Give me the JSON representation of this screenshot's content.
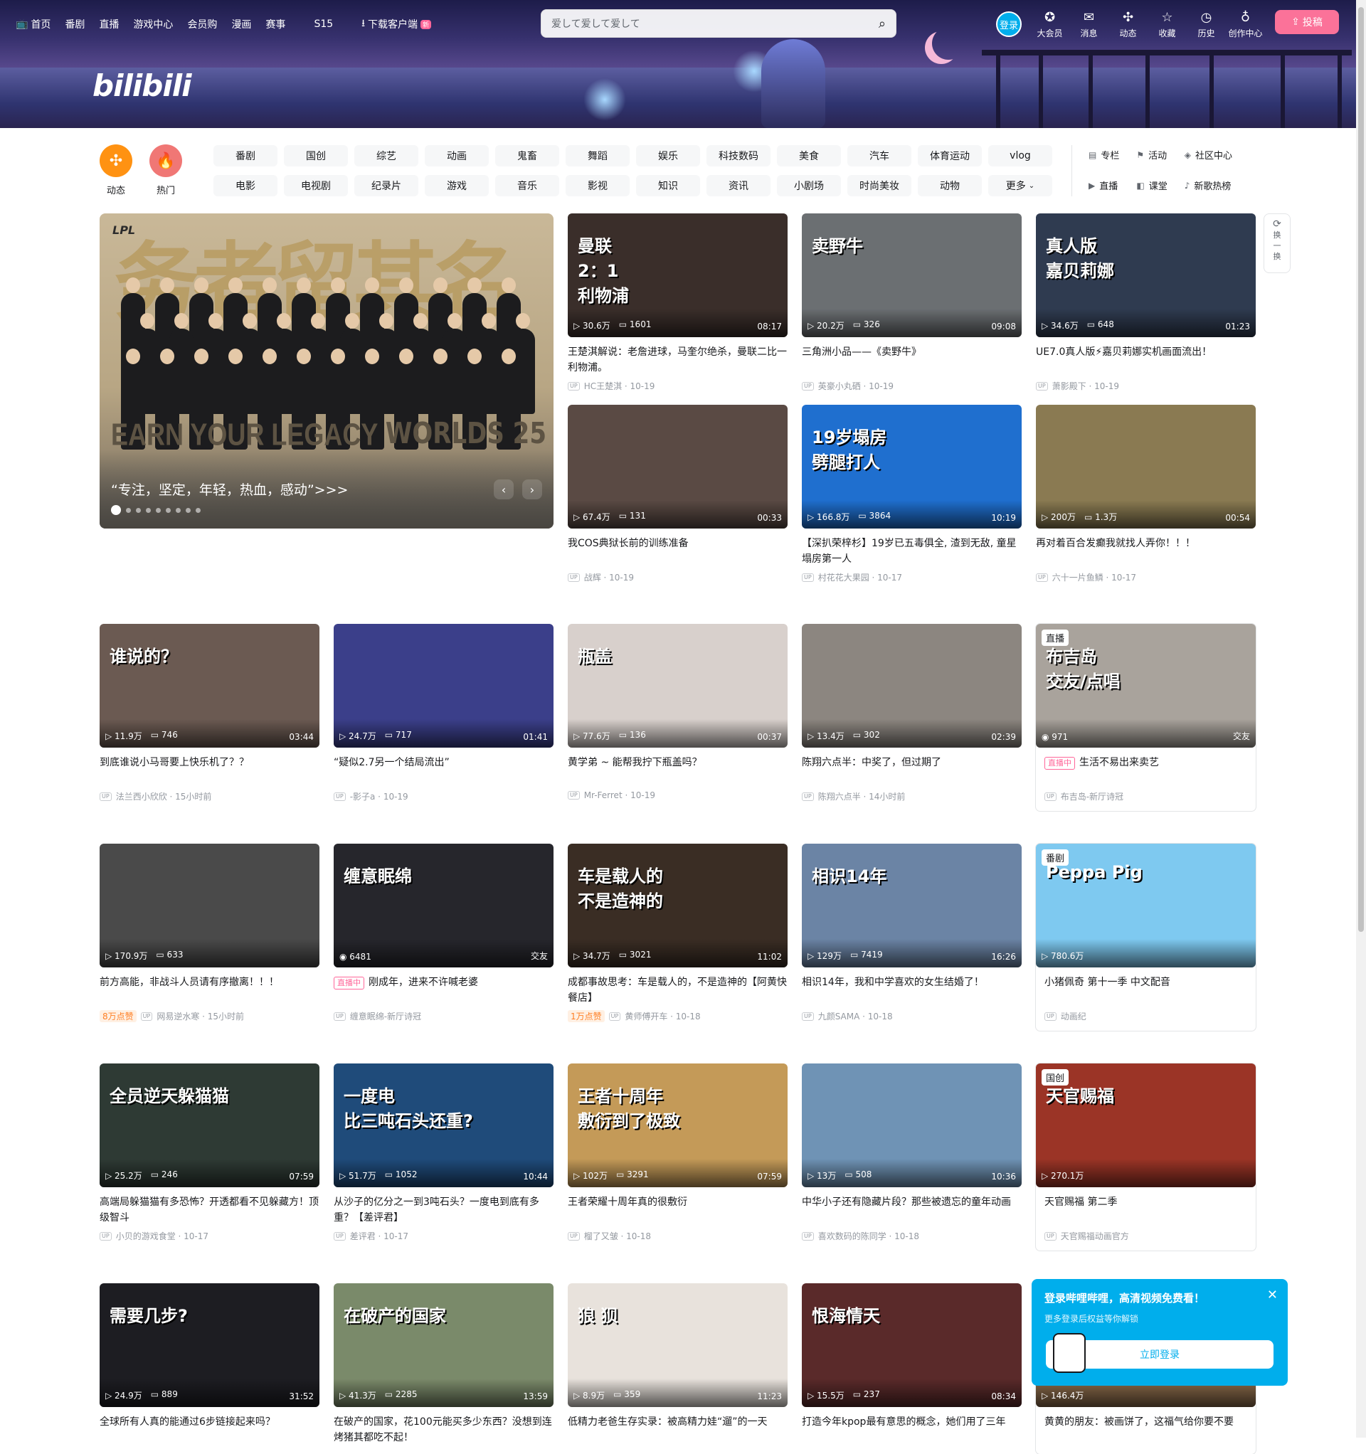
{
  "header": {
    "nav": [
      "首页",
      "番剧",
      "直播",
      "游戏中心",
      "会员购",
      "漫画",
      "赛事",
      "S15",
      "下载客户端"
    ],
    "new_badge": "新",
    "search_placeholder": "爱して爱して爱して",
    "login": "登录",
    "right_nav": [
      {
        "label": "大会员",
        "icon": "vip-icon"
      },
      {
        "label": "消息",
        "icon": "message-icon"
      },
      {
        "label": "动态",
        "icon": "dynamic-icon"
      },
      {
        "label": "收藏",
        "icon": "favorite-icon"
      },
      {
        "label": "历史",
        "icon": "history-icon"
      },
      {
        "label": "创作中心",
        "icon": "creator-icon"
      }
    ],
    "upload": "投稿",
    "logo": "bilibili"
  },
  "quick": [
    {
      "label": "动态",
      "color": "#ff9212"
    },
    {
      "label": "热门",
      "color": "#f07775"
    }
  ],
  "channels": [
    "番剧",
    "国创",
    "综艺",
    "动画",
    "鬼畜",
    "舞蹈",
    "娱乐",
    "科技数码",
    "美食",
    "汽车",
    "体育运动",
    "vlog",
    "电影",
    "电视剧",
    "纪录片",
    "游戏",
    "音乐",
    "影视",
    "知识",
    "资讯",
    "小剧场",
    "时尚美妆",
    "动物",
    "更多"
  ],
  "extra": [
    "专栏",
    "活动",
    "社区中心",
    "直播",
    "课堂",
    "新歌热榜"
  ],
  "carousel": {
    "caption": "“专注，坚定，年轻，热血，感动”>>>",
    "earn": "EARN YOUR LEGACY",
    "worlds": "WORLDS 25",
    "lpl": "LPL",
    "calli": "务者留其名"
  },
  "refresh": [
    "换",
    "一",
    "换"
  ],
  "cards": [
    {
      "title": "王楚淇解说：老詹进球，马奎尔绝杀，曼联二比一利物浦。",
      "plays": "30.6万",
      "danmaku": "1601",
      "duration": "08:17",
      "up": "HC王楚淇",
      "date": "10-19",
      "art": "曼联\n2：1\n利物浦",
      "bg": "#3a2e2a"
    },
    {
      "title": "三角洲小品——《卖野牛》",
      "plays": "20.2万",
      "danmaku": "326",
      "duration": "09:08",
      "up": "英豪小丸硒",
      "date": "10-19",
      "art": "卖野牛",
      "bg": "#6b6f72"
    },
    {
      "title": "UE7.0真人版⚡嘉贝莉娜实机画面流出！",
      "plays": "34.6万",
      "danmaku": "648",
      "duration": "01:23",
      "up": "萧影殿下",
      "date": "10-19",
      "art": "真人版\n嘉贝莉娜",
      "bg": "#2f3b50"
    },
    {
      "title": "我COS典狱长前的训练准备",
      "plays": "67.4万",
      "danmaku": "131",
      "duration": "00:33",
      "up": "战辉",
      "date": "10-19",
      "art": "",
      "bg": "#5a4a44"
    },
    {
      "title": "【深扒荣梓杉】19岁已五毒俱全, 渣到无敌, 童星塌房第一人",
      "plays": "166.8万",
      "danmaku": "3864",
      "duration": "10:19",
      "up": "村花花大果园",
      "date": "10-17",
      "art": "19岁塌房\n劈腿打人",
      "bg": "#1f6fcf"
    },
    {
      "title": "再对着百合发癫我就找人弄你！！！",
      "plays": "200万",
      "danmaku": "1.3万",
      "duration": "00:54",
      "up": "六十一片鱼鳞",
      "date": "10-17",
      "art": "",
      "bg": "#8a7a52"
    },
    {
      "title": "到底谁说小马哥要上快乐机了？？",
      "plays": "11.9万",
      "danmaku": "746",
      "duration": "03:44",
      "up": "法兰西小欣欣",
      "date": "15小时前",
      "art": "谁说的？",
      "bg": "#6b5a52"
    },
    {
      "title": "“疑似2.7另一个结局流出”",
      "plays": "24.7万",
      "danmaku": "717",
      "duration": "01:41",
      "up": "-影子a",
      "date": "10-19",
      "art": "",
      "bg": "#3b3f8a"
    },
    {
      "title": "黄学弟 ~ 能帮我拧下瓶盖吗？",
      "plays": "77.6万",
      "danmaku": "136",
      "duration": "00:37",
      "up": "Mr-Ferret",
      "date": "10-19",
      "art": "瓶盖",
      "bg": "#d8d0cc"
    },
    {
      "title": "陈翔六点半：中奖了，但过期了",
      "plays": "13.4万",
      "danmaku": "302",
      "duration": "02:39",
      "up": "陈翔六点半",
      "date": "14小时前",
      "art": "",
      "bg": "#8c8680"
    },
    {
      "title": "生活不易出来卖艺",
      "viewers": "971",
      "area": "交友",
      "up": "布吉岛-新厅诗冠",
      "tag": "直播",
      "live": "直播中",
      "art": "布吉岛\n交友/点唱",
      "bg": "#a9a39c",
      "type": "live"
    },
    {
      "title": "前方高能，非战斗人员请有序撤离！！！",
      "plays": "170.9万",
      "danmaku": "633",
      "duration": "",
      "up": "网易逆水寒",
      "date": "15小时前",
      "hot": "8万点赞",
      "art": "",
      "bg": "#4a4a4a"
    },
    {
      "title": "刚成年，进来不许喊老婆",
      "viewers": "6481",
      "area": "交友",
      "up": "缠意眠绵-新厅诗冠",
      "live": "直播中",
      "art": "缠意眠绵",
      "bg": "#26262c",
      "type": "live2"
    },
    {
      "title": "成都事故思考：车是载人的，不是造神的【阿黄快餐店】",
      "plays": "34.7万",
      "danmaku": "3021",
      "duration": "11:02",
      "up": "黄师傅开车",
      "date": "10-18",
      "hot": "1万点赞",
      "art": "车是载人的\n不是造神的",
      "bg": "#3a2d24"
    },
    {
      "title": "相识14年，我和中学喜欢的女生结婚了！",
      "plays": "129万",
      "danmaku": "7419",
      "duration": "16:26",
      "up": "九颜SAMA",
      "date": "10-18",
      "art": "相识14年",
      "bg": "#6b84a5"
    },
    {
      "title": "小猪佩奇 第十一季 中文配音",
      "plays": "780.6万",
      "up": "动画纪",
      "tag": "番剧",
      "art": "Peppa Pig",
      "bg": "#7ec9f0",
      "type": "special"
    },
    {
      "title": "高端局躲猫猫有多恐怖？开透都看不见躲藏方！顶级智斗",
      "plays": "25.2万",
      "danmaku": "246",
      "duration": "07:59",
      "up": "小贝的游戏食堂",
      "date": "10-17",
      "art": "全员逆天躲猫猫",
      "bg": "#2e3a34"
    },
    {
      "title": "从沙子的亿分之一到3吨石头？一度电到底有多重？【差评君】",
      "plays": "51.7万",
      "danmaku": "1052",
      "duration": "10:44",
      "up": "差评君",
      "date": "10-17",
      "art": "一度电\n比三吨石头还重?",
      "bg": "#1f4b7a"
    },
    {
      "title": "王者荣耀十周年真的很敷衍",
      "plays": "102万",
      "danmaku": "3291",
      "duration": "07:59",
      "up": "榴了又皱",
      "date": "10-18",
      "art": "王者十周年\n敷衍到了极致",
      "bg": "#c49a58"
    },
    {
      "title": "中华小子还有隐藏片段？那些被遗忘的童年动画",
      "plays": "13万",
      "danmaku": "508",
      "duration": "10:36",
      "up": "喜欢数码的陈同学",
      "date": "10-18",
      "art": "",
      "bg": "#6f93b5"
    },
    {
      "title": "天官赐福 第二季",
      "plays": "270.1万",
      "up": "天官赐福动画官方",
      "tag": "国创",
      "art": "天官赐福",
      "bg": "#9b3426",
      "type": "special"
    },
    {
      "title": "全球所有人真的能通过6步链接起来吗？",
      "plays": "24.9万",
      "danmaku": "889",
      "duration": "31:52",
      "up": "",
      "date": "",
      "art": "需要几步?",
      "bg": "#1d1d22"
    },
    {
      "title": "在破产的国家，花100元能买多少东西？没想到连烤猪其都吃不起！",
      "plays": "41.3万",
      "danmaku": "2285",
      "duration": "13:59",
      "up": "",
      "date": "",
      "art": "在破产的国家",
      "bg": "#7a8a6a"
    },
    {
      "title": "低精力老爸生存实录：被高精力娃“遛”的一天",
      "plays": "8.9万",
      "danmaku": "359",
      "duration": "11:23",
      "up": "",
      "date": "",
      "art": "狼   狈",
      "bg": "#e8e2dc"
    },
    {
      "title": "打造今年kpop最有意思的概念，她们用了三年",
      "plays": "15.5万",
      "danmaku": "237",
      "duration": "08:34",
      "up": "",
      "date": "",
      "art": "恨海情天",
      "bg": "#5a2a2a"
    },
    {
      "title": "黄黄的朋友：被画饼了，这福气给你要不要",
      "plays": "146.4万",
      "up": "",
      "art": "",
      "bg": "#8a6a4a",
      "type": "special"
    }
  ],
  "popup": {
    "heading": "登录哔哩哔哩，高清视频免费看！",
    "sub": "更多登录后权益等你解锁",
    "button": "立即登录"
  }
}
